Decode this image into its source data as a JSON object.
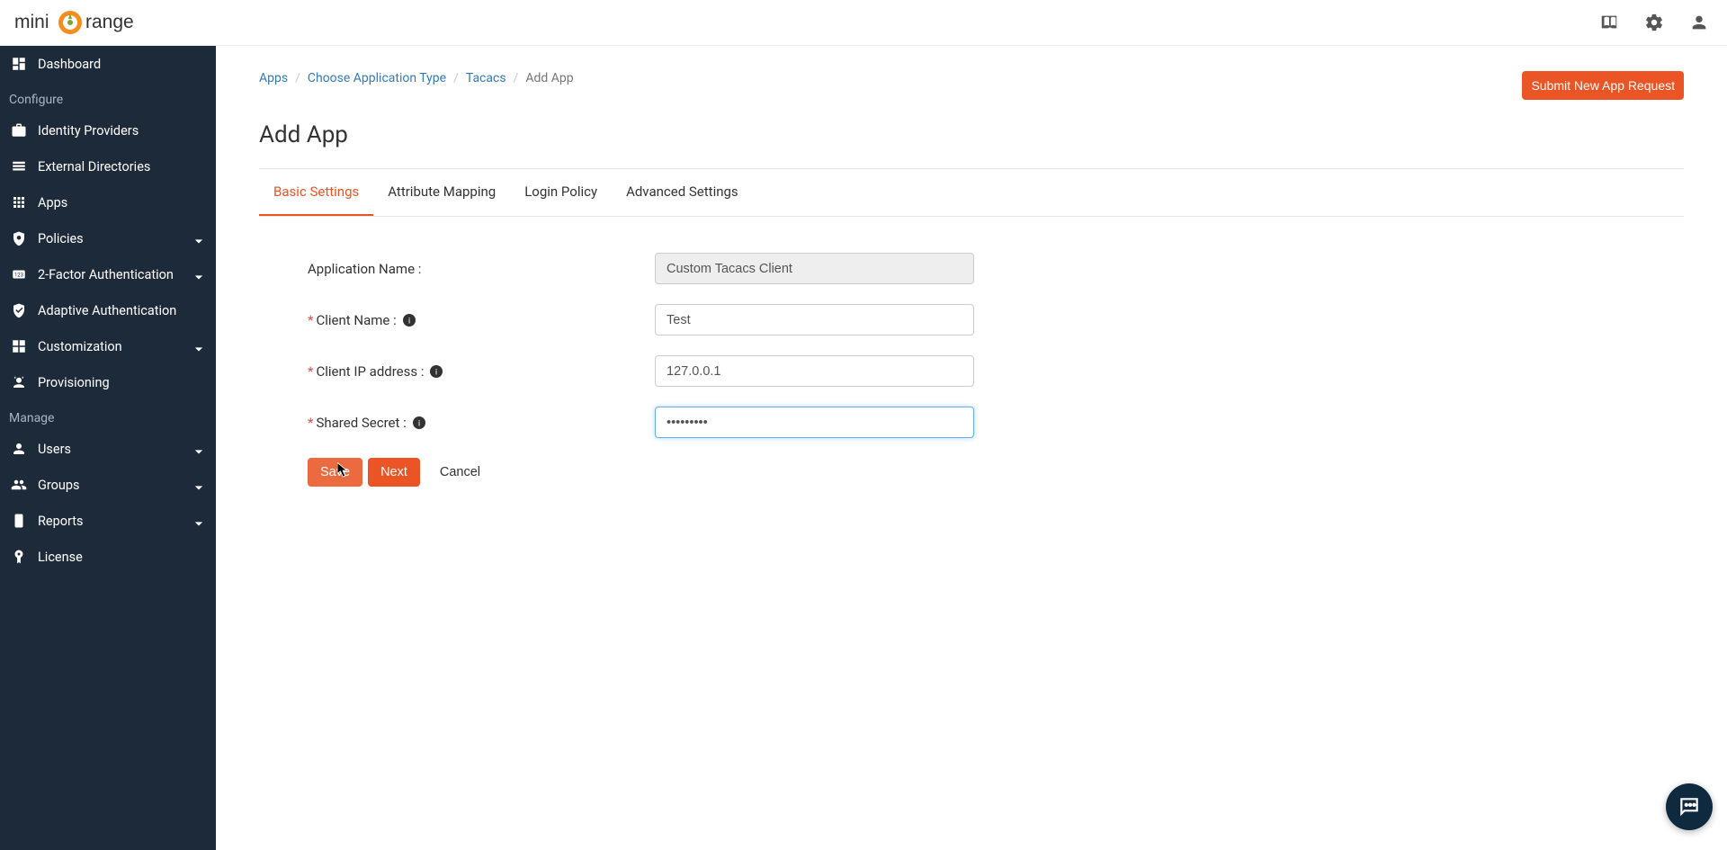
{
  "brand": {
    "part1": "mini",
    "part2": "range"
  },
  "header_icons": {
    "docs": "book-icon",
    "settings": "gear-icon",
    "profile": "person-icon"
  },
  "sidebar": {
    "dashboard": "Dashboard",
    "section_configure": "Configure",
    "identity_providers": "Identity Providers",
    "external_directories": "External Directories",
    "apps": "Apps",
    "policies": "Policies",
    "two_factor": "2-Factor Authentication",
    "adaptive_auth": "Adaptive Authentication",
    "customization": "Customization",
    "provisioning": "Provisioning",
    "section_manage": "Manage",
    "users": "Users",
    "groups": "Groups",
    "reports": "Reports",
    "license": "License"
  },
  "breadcrumb": {
    "apps": "Apps",
    "choose_type": "Choose Application Type",
    "tacacs": "Tacacs",
    "current": "Add App"
  },
  "submit_button": "Submit New App Request",
  "page_title": "Add App",
  "tabs": {
    "basic": "Basic Settings",
    "attribute": "Attribute Mapping",
    "login": "Login Policy",
    "advanced": "Advanced Settings"
  },
  "form": {
    "app_name_label": "Application Name :",
    "app_name_value": "Custom Tacacs Client",
    "client_name_label": "Client Name :",
    "client_name_value": "Test",
    "client_ip_label": "Client IP address :",
    "client_ip_value": "127.0.0.1",
    "shared_secret_label": "Shared Secret :",
    "shared_secret_value": "•••••••••",
    "save": "Save",
    "next": "Next",
    "cancel": "Cancel"
  }
}
